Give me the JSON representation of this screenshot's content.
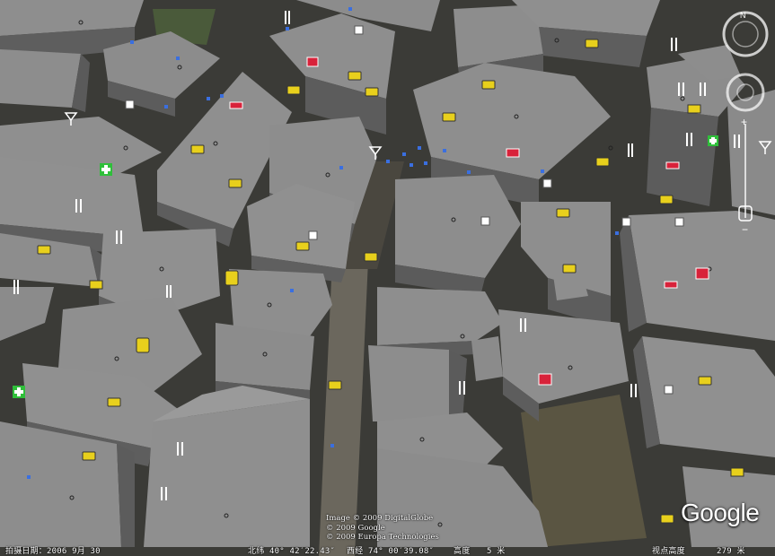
{
  "map": {
    "imagery_date_label": "拍摄日期：2006 9月 30",
    "lat_label": "北纬  40° 42′22.43″",
    "lon_label": "西经  74° 00′39.08″",
    "elevation_label": "高度",
    "elevation_value": "5 米",
    "eye_alt_label": "视点高度",
    "eye_alt_value": "279 米",
    "credits": [
      "Image © 2009 DigitalGlobe",
      "© 2009 Google",
      "© 2009 Europa Technologies"
    ],
    "logo": "Google"
  },
  "colors": {
    "street": "#3d3d38",
    "roof": "#8f8f8f",
    "wall": "#5e5e5e",
    "poi_yellow": "#e8d01c",
    "poi_red": "#d8223a",
    "poi_green": "#2fbf3a"
  }
}
